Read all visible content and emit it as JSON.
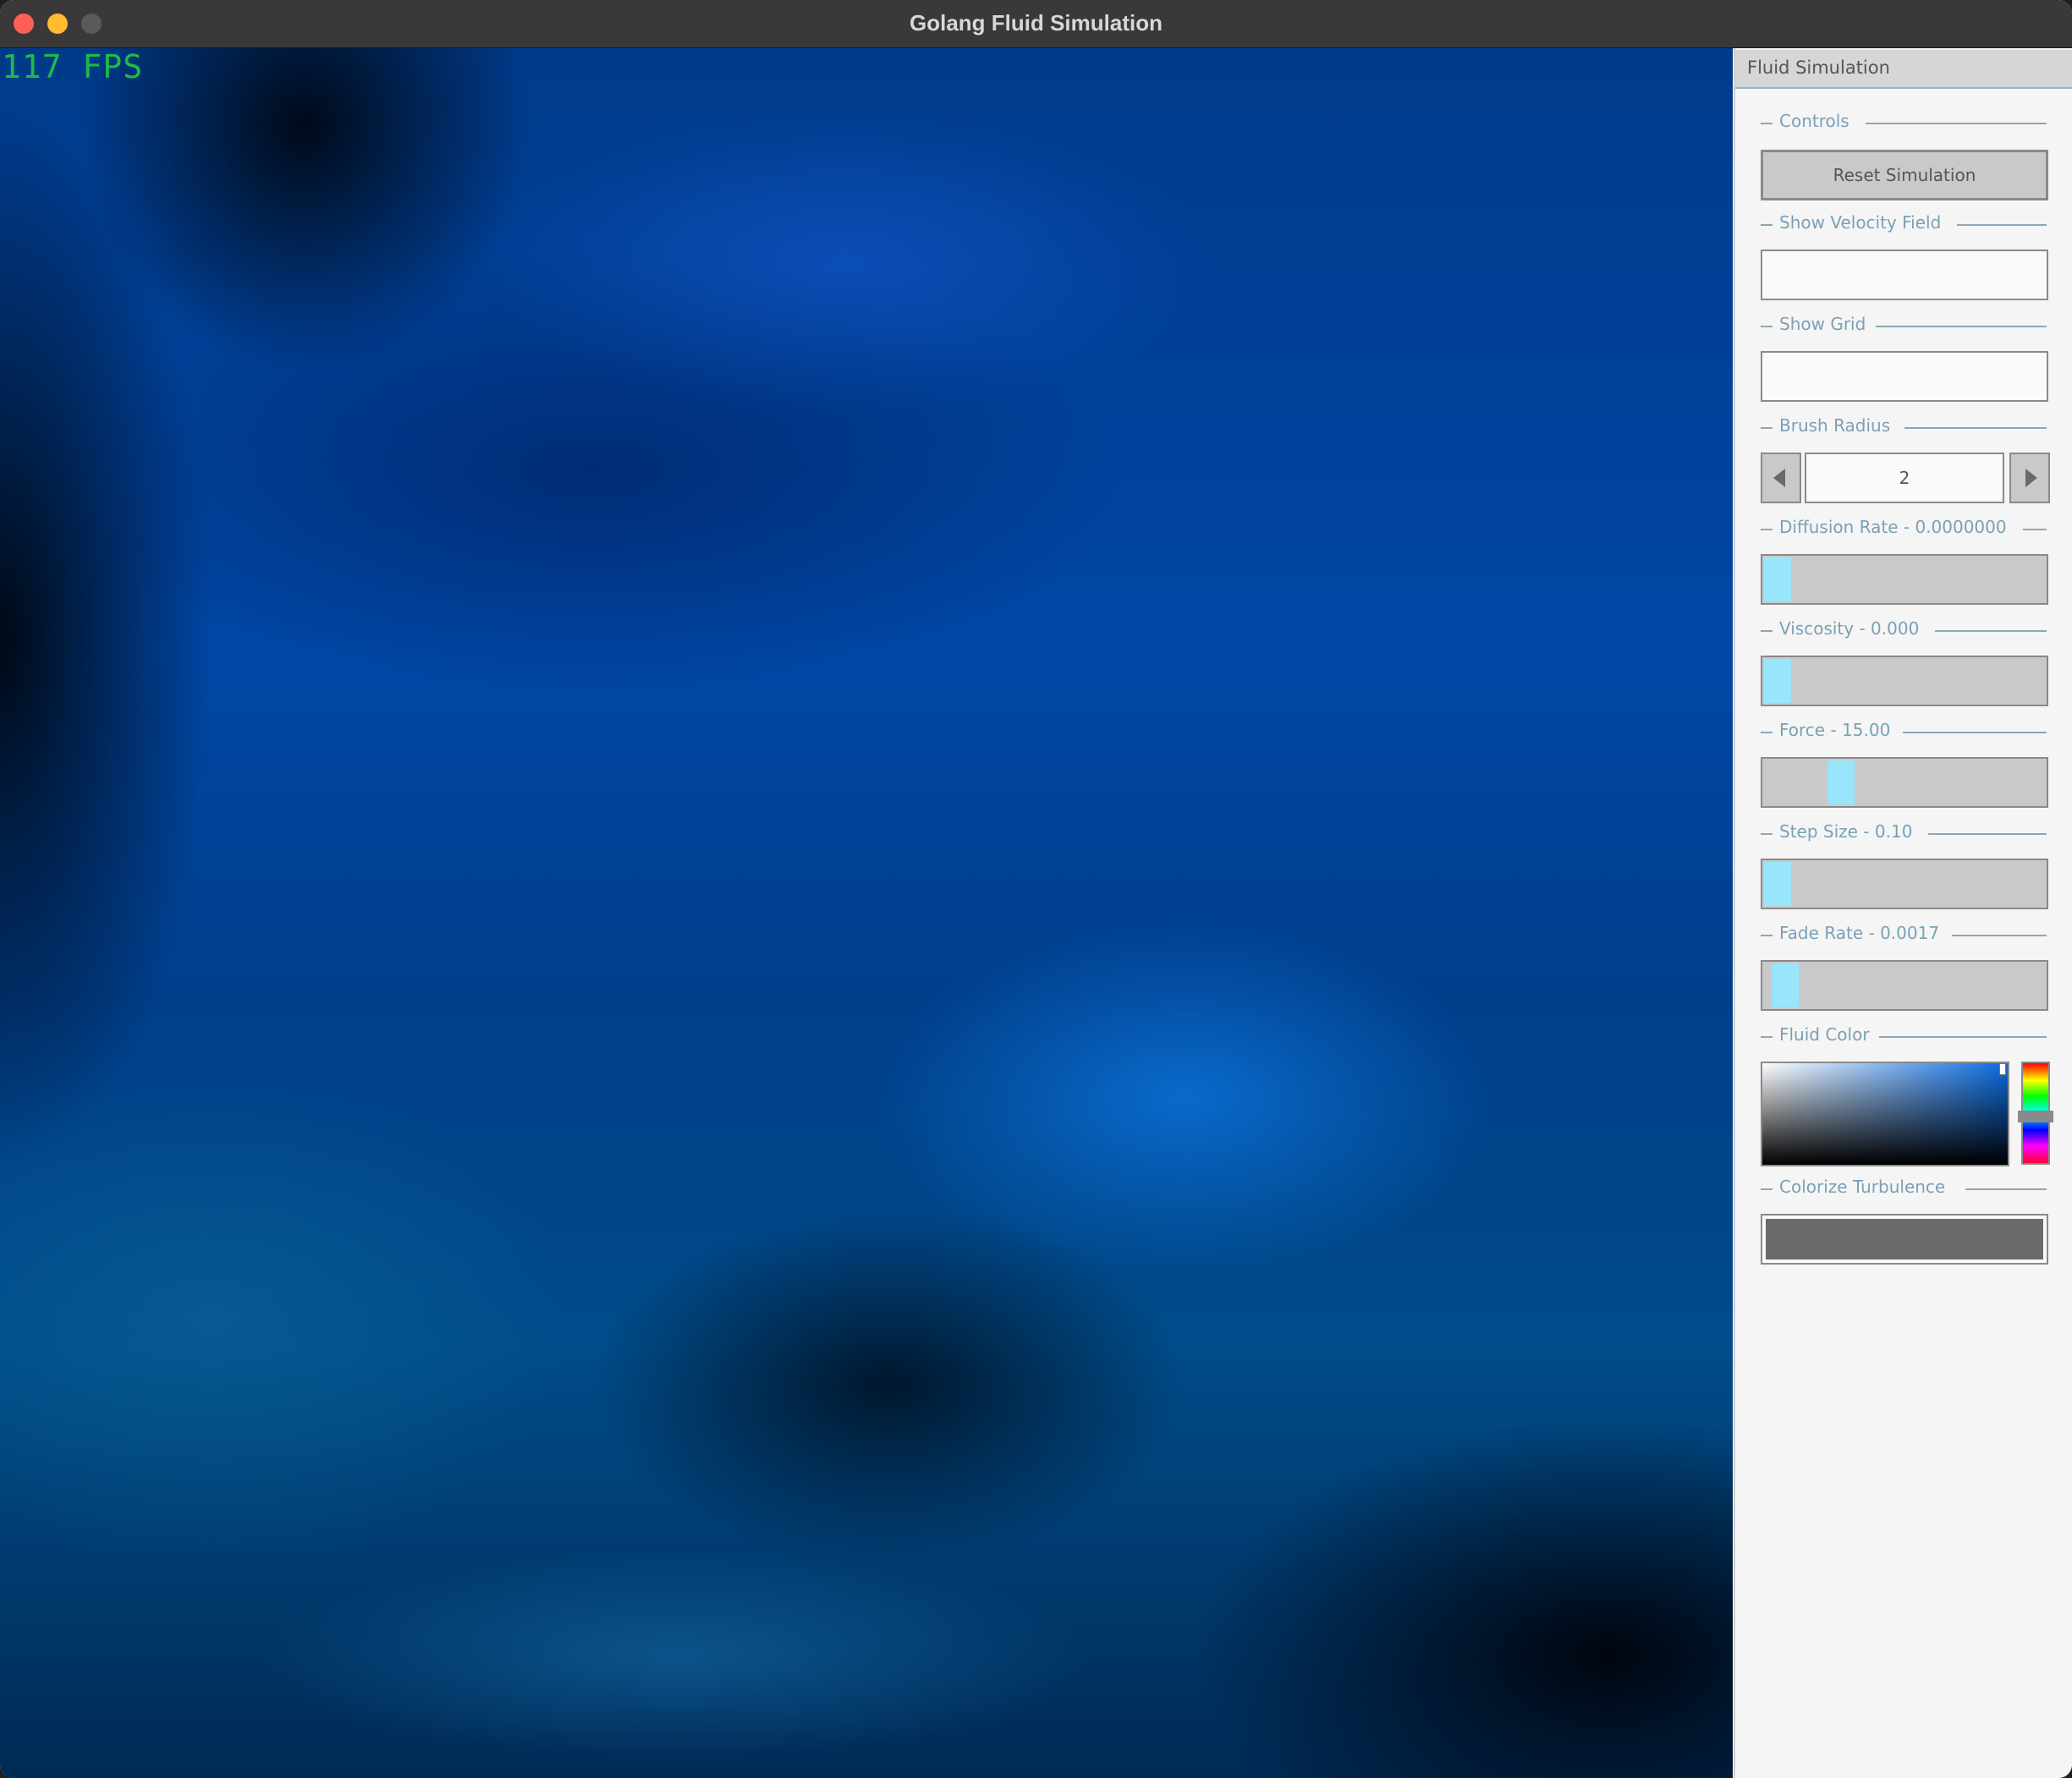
{
  "window": {
    "title": "Golang Fluid Simulation"
  },
  "canvas": {
    "fps_text": "117 FPS"
  },
  "panel": {
    "header": "Fluid Simulation",
    "controls_label": "Controls",
    "reset_button": "Reset Simulation",
    "show_velocity_label": "Show Velocity Field",
    "show_velocity_checked": false,
    "show_grid_label": "Show Grid",
    "show_grid_checked": false,
    "brush_radius_label": "Brush Radius",
    "brush_radius_value": "2",
    "diffusion_label": "Diffusion Rate - 0.0000000",
    "diffusion_level": 0.0,
    "viscosity_label": "Viscosity - 0.000",
    "viscosity_level": 0.0,
    "force_label": "Force - 15.00",
    "force_level": 0.25,
    "step_size_label": "Step Size - 0.10",
    "step_size_level": 0.0,
    "fade_rate_label": "Fade Rate - 0.0017",
    "fade_rate_level": 0.03,
    "fluid_color_label": "Fluid Color",
    "fluid_color_hex": "#0a6be0",
    "colorize_label": "Colorize Turbulence",
    "colorize_on": true
  },
  "colors": {
    "fps": "#1bbc4a",
    "slider_thumb": "#97e6fb",
    "section_text": "#7aa0b6"
  },
  "icons": {
    "close": "close-icon",
    "minimize": "minimize-icon",
    "zoom": "zoom-icon",
    "decrement": "arrow-left-icon",
    "increment": "arrow-right-icon"
  }
}
